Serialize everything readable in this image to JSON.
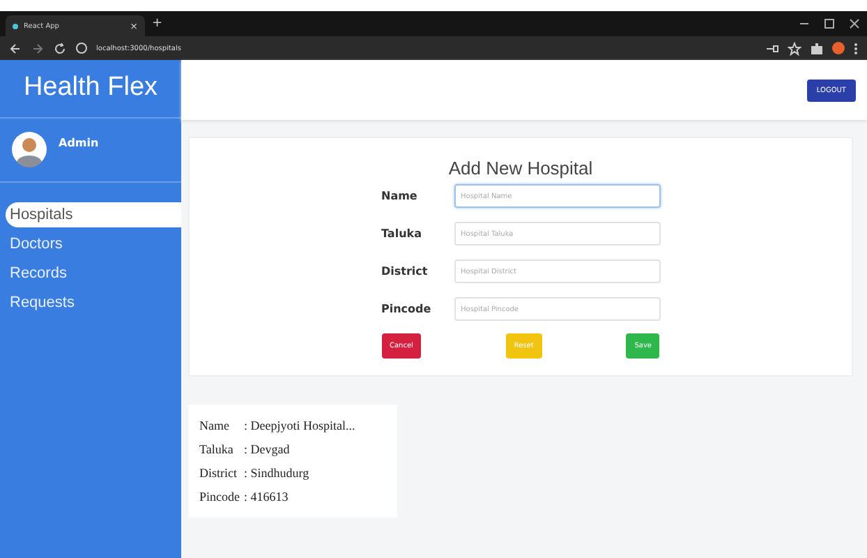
{
  "browser": {
    "tab_title": "React App",
    "tab_close": "×",
    "new_tab": "+",
    "url": "localhost:3000/hospitals"
  },
  "sidebar": {
    "brand": "Health Flex",
    "user": "Admin",
    "items": [
      {
        "label": "Hospitals",
        "selected": true
      },
      {
        "label": "Doctors",
        "selected": false
      },
      {
        "label": "Records",
        "selected": false
      },
      {
        "label": "Requests",
        "selected": false
      }
    ]
  },
  "header": {
    "logout": "LOGOUT"
  },
  "form": {
    "title": "Add New Hospital",
    "fields": [
      {
        "label": "Name",
        "placeholder": "Hospital Name",
        "focused": true
      },
      {
        "label": "Taluka",
        "placeholder": "Hospital Taluka",
        "focused": false
      },
      {
        "label": "District",
        "placeholder": "Hospital District",
        "focused": false
      },
      {
        "label": "Pincode",
        "placeholder": "Hospital Pincode",
        "focused": false
      }
    ],
    "buttons": [
      {
        "label": "Cancel",
        "kind": "danger"
      },
      {
        "label": "Reset",
        "kind": "warning"
      },
      {
        "label": "Save",
        "kind": "success"
      }
    ]
  },
  "hospital_card": {
    "rows": [
      {
        "label": "Name",
        "value": ": Deepjyoti Hospital..."
      },
      {
        "label": "Taluka",
        "value": ": Devgad"
      },
      {
        "label": "District",
        "value": ": Sindhudurg"
      },
      {
        "label": "Pincode",
        "value": ": 416613"
      }
    ]
  }
}
